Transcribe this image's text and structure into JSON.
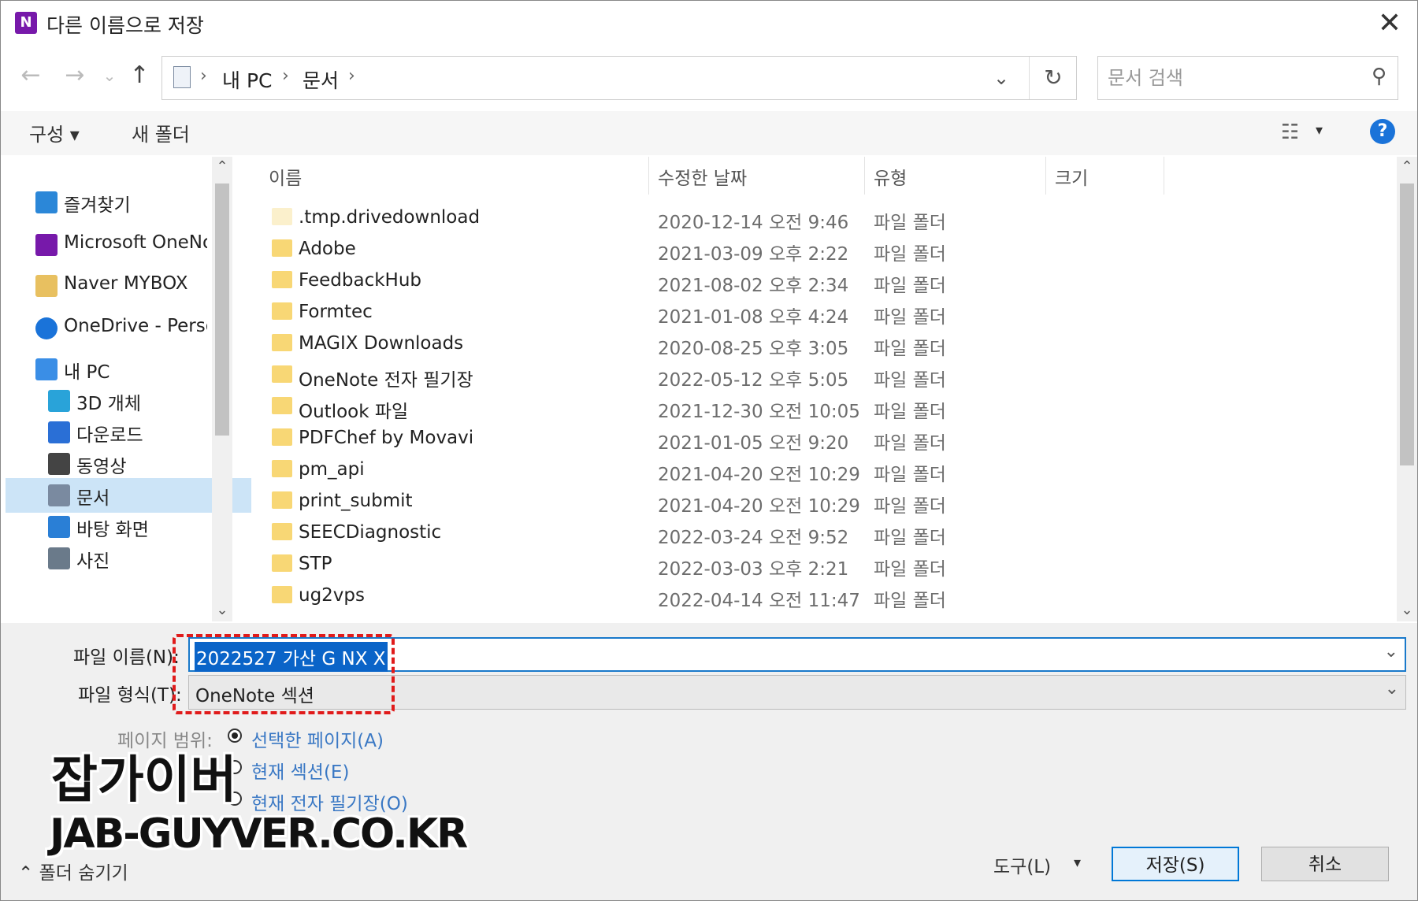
{
  "window": {
    "title": "다른 이름으로 저장",
    "app_icon_letter": "N",
    "close_glyph": "✕"
  },
  "navbar": {
    "back_glyph": "←",
    "forward_glyph": "→",
    "recent_glyph": "⌄",
    "up_glyph": "↑",
    "breadcrumb": [
      "내 PC",
      "문서"
    ],
    "breadcrumb_sep": "›",
    "dropdown_glyph": "⌄",
    "refresh_glyph": "↻",
    "search_placeholder": "문서 검색",
    "search_glyph": "⚲"
  },
  "toolbar": {
    "organize": "구성 ▾",
    "new_folder": "새 폴더",
    "view_glyph": "☷",
    "view_drop": "▾",
    "help": "?"
  },
  "sidebar": {
    "items": [
      {
        "label": "즐겨찾기",
        "icon": "star-icon",
        "color": "#2b87d8"
      },
      {
        "label": "Microsoft OneNote",
        "icon": "onenote-icon",
        "color": "#7719aa"
      },
      {
        "label": "Naver MYBOX",
        "icon": "mybox-icon",
        "color": "#e8c060"
      },
      {
        "label": "OneDrive - Personal",
        "icon": "cloud-icon",
        "color": "#1a73d9"
      },
      {
        "label": "내 PC",
        "icon": "pc-icon",
        "color": "#3a8ee6"
      },
      {
        "label": "3D 개체",
        "icon": "cube-icon",
        "color": "#29a3d9"
      },
      {
        "label": "다운로드",
        "icon": "download-icon",
        "color": "#2a6fd6"
      },
      {
        "label": "동영상",
        "icon": "film-icon",
        "color": "#444444"
      },
      {
        "label": "문서",
        "icon": "document-icon",
        "color": "#7a8aa0"
      },
      {
        "label": "바탕 화면",
        "icon": "desktop-icon",
        "color": "#2a7fd6"
      },
      {
        "label": "사진",
        "icon": "picture-icon",
        "color": "#6a7a8a"
      }
    ],
    "selected_index": 8
  },
  "files": {
    "columns": {
      "name": "이름",
      "date": "수정한 날짜",
      "type": "유형",
      "size": "크기"
    },
    "rows": [
      {
        "name": ".tmp.drivedownload",
        "date": "2020-12-14 오전 9:46",
        "type": "파일 폴더"
      },
      {
        "name": "Adobe",
        "date": "2021-03-09 오후 2:22",
        "type": "파일 폴더"
      },
      {
        "name": "FeedbackHub",
        "date": "2021-08-02 오후 2:34",
        "type": "파일 폴더"
      },
      {
        "name": "Formtec",
        "date": "2021-01-08 오후 4:24",
        "type": "파일 폴더"
      },
      {
        "name": "MAGIX Downloads",
        "date": "2020-08-25 오후 3:05",
        "type": "파일 폴더"
      },
      {
        "name": "OneNote 전자 필기장",
        "date": "2022-05-12 오후 5:05",
        "type": "파일 폴더"
      },
      {
        "name": "Outlook 파일",
        "date": "2021-12-30 오전 10:05",
        "type": "파일 폴더"
      },
      {
        "name": "PDFChef by Movavi",
        "date": "2021-01-05 오전 9:20",
        "type": "파일 폴더"
      },
      {
        "name": "pm_api",
        "date": "2021-04-20 오전 10:29",
        "type": "파일 폴더"
      },
      {
        "name": "print_submit",
        "date": "2021-04-20 오전 10:29",
        "type": "파일 폴더"
      },
      {
        "name": "SEECDiagnostic",
        "date": "2022-03-24 오전 9:52",
        "type": "파일 폴더"
      },
      {
        "name": "STP",
        "date": "2022-03-03 오후 2:21",
        "type": "파일 폴더"
      },
      {
        "name": "ug2vps",
        "date": "2022-04-14 오전 11:47",
        "type": "파일 폴더"
      }
    ]
  },
  "form": {
    "filename_label": "파일 이름(N):",
    "filename_value": "2022527 가산 G NX X",
    "filetype_label": "파일 형식(T):",
    "filetype_value": "OneNote 섹션",
    "combo_glyph": "⌄",
    "page_range_label": "페이지 범위:",
    "radios": [
      {
        "label": "선택한 페이지(A)",
        "checked": true
      },
      {
        "label": "현재 섹션(E)",
        "checked": false
      },
      {
        "label": "현재 전자 필기장(O)",
        "checked": false
      }
    ]
  },
  "watermark": {
    "line1": "잡가이버",
    "line2": "JAB-GUYVER.CO.KR"
  },
  "footer": {
    "hide_folders": "⌃ 폴더 숨기기",
    "tools": "도구(L)",
    "tools_drop": "▾",
    "save": "저장(S)",
    "cancel": "취소"
  },
  "colors": {
    "accent": "#0078d7",
    "folder": "#f8d775",
    "highlight": "#e01b1b",
    "selection": "#cce4f7"
  }
}
